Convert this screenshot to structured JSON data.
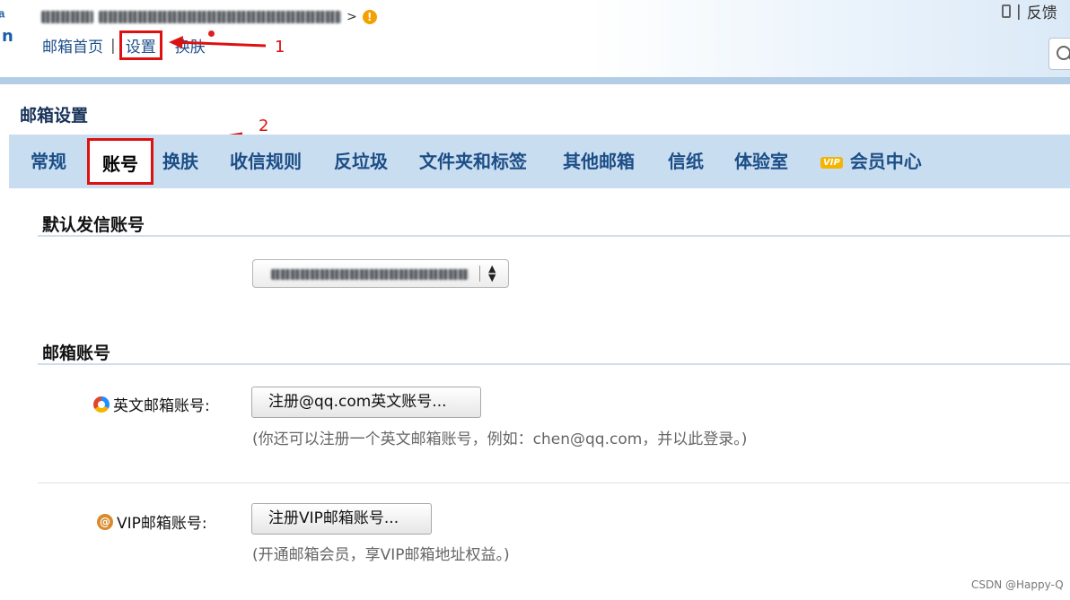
{
  "header": {
    "user_suffix": ">",
    "links": {
      "home": "邮箱首页",
      "separator": "|",
      "settings": "设置",
      "skin": "换肤"
    },
    "feedback_sep": "|",
    "feedback": "反馈"
  },
  "annotations": {
    "arrow1": "1",
    "arrow2": "2"
  },
  "page": {
    "title": "邮箱设置"
  },
  "tabs": [
    {
      "label": "常规"
    },
    {
      "label": "账号",
      "active": true
    },
    {
      "label": "换肤"
    },
    {
      "label": "收信规则"
    },
    {
      "label": "反垃圾"
    },
    {
      "label": "文件夹和标签"
    },
    {
      "label": "其他邮箱"
    },
    {
      "label": "信纸"
    },
    {
      "label": "体验室"
    },
    {
      "label": "会员中心",
      "badge": "VIP"
    }
  ],
  "default_sender": {
    "heading": "默认发信账号"
  },
  "mailbox_accounts": {
    "heading": "邮箱账号",
    "english": {
      "label": "英文邮箱账号:",
      "button": "注册@qq.com英文账号...",
      "hint": "(你还可以注册一个英文邮箱账号，例如：chen@qq.com，并以此登录。)"
    },
    "vip": {
      "label": "VIP邮箱账号:",
      "button": "注册VIP邮箱账号...",
      "hint": "(开通邮箱会员，享VIP邮箱地址权益。)"
    }
  },
  "watermark": "CSDN @Happy-Q",
  "colors": {
    "tab_bar": "#c9ddf1",
    "tab_text": "#1c4e86",
    "annotation_red": "#d11"
  }
}
